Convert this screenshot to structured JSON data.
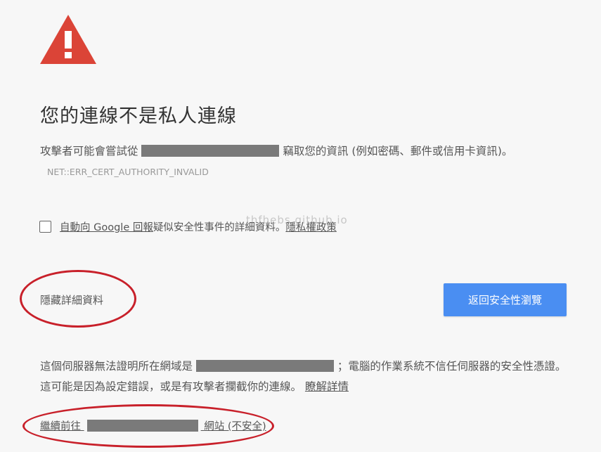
{
  "title": "您的連線不是私人連線",
  "attack": {
    "prefix": "攻擊者可能會嘗試從",
    "suffix": "竊取您的資訊 (例如密碼、郵件或信用卡資訊)。",
    "error_code": "NET::ERR_CERT_AUTHORITY_INVALID"
  },
  "report": {
    "link1": "自動向 Google 回報",
    "middle": "疑似安全性事件的詳細資料。",
    "link2": "隱私權政策"
  },
  "watermark": "thfhebs.github.io",
  "details_toggle": "隱藏詳細資料",
  "back_button": "返回安全性瀏覽",
  "explain": {
    "prefix": "這個伺服器無法證明所在網域是",
    "middle": "；電腦的作業系統不信任伺服器的安全性憑證。這可能是因為設定錯誤，或是有攻擊者攔截你的連線。",
    "learn_more": "瞭解詳情"
  },
  "proceed": {
    "prefix": "繼續前往",
    "suffix": "網站 (不安全)"
  },
  "colors": {
    "warning_red": "#db4437",
    "button_blue": "#4a8ef2",
    "annotation_red": "#c8202a"
  }
}
